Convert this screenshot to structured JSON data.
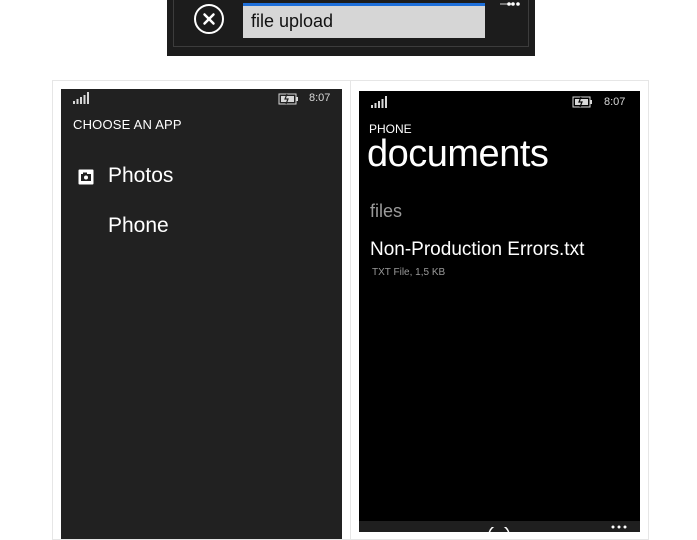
{
  "top_bar": {
    "field_value": "file upload",
    "icons": [
      "close-icon",
      "more-dots-icon"
    ]
  },
  "chooser_screen": {
    "status_time": "8:07",
    "title": "CHOOSE AN APP",
    "items": [
      {
        "label": "Photos",
        "icon": "photos-icon"
      },
      {
        "label": "Phone"
      }
    ]
  },
  "documents_screen": {
    "status_time": "8:07",
    "small_heading": "PHONE",
    "big_heading": "documents",
    "section_header": "files",
    "files": [
      {
        "name": "Non-Production Errors.txt",
        "meta": "TXT File, 1,5 KB"
      }
    ]
  },
  "colors": {
    "accent": "#1e6fd9",
    "chooser_background": "#212121",
    "documents_background": "#000000"
  }
}
